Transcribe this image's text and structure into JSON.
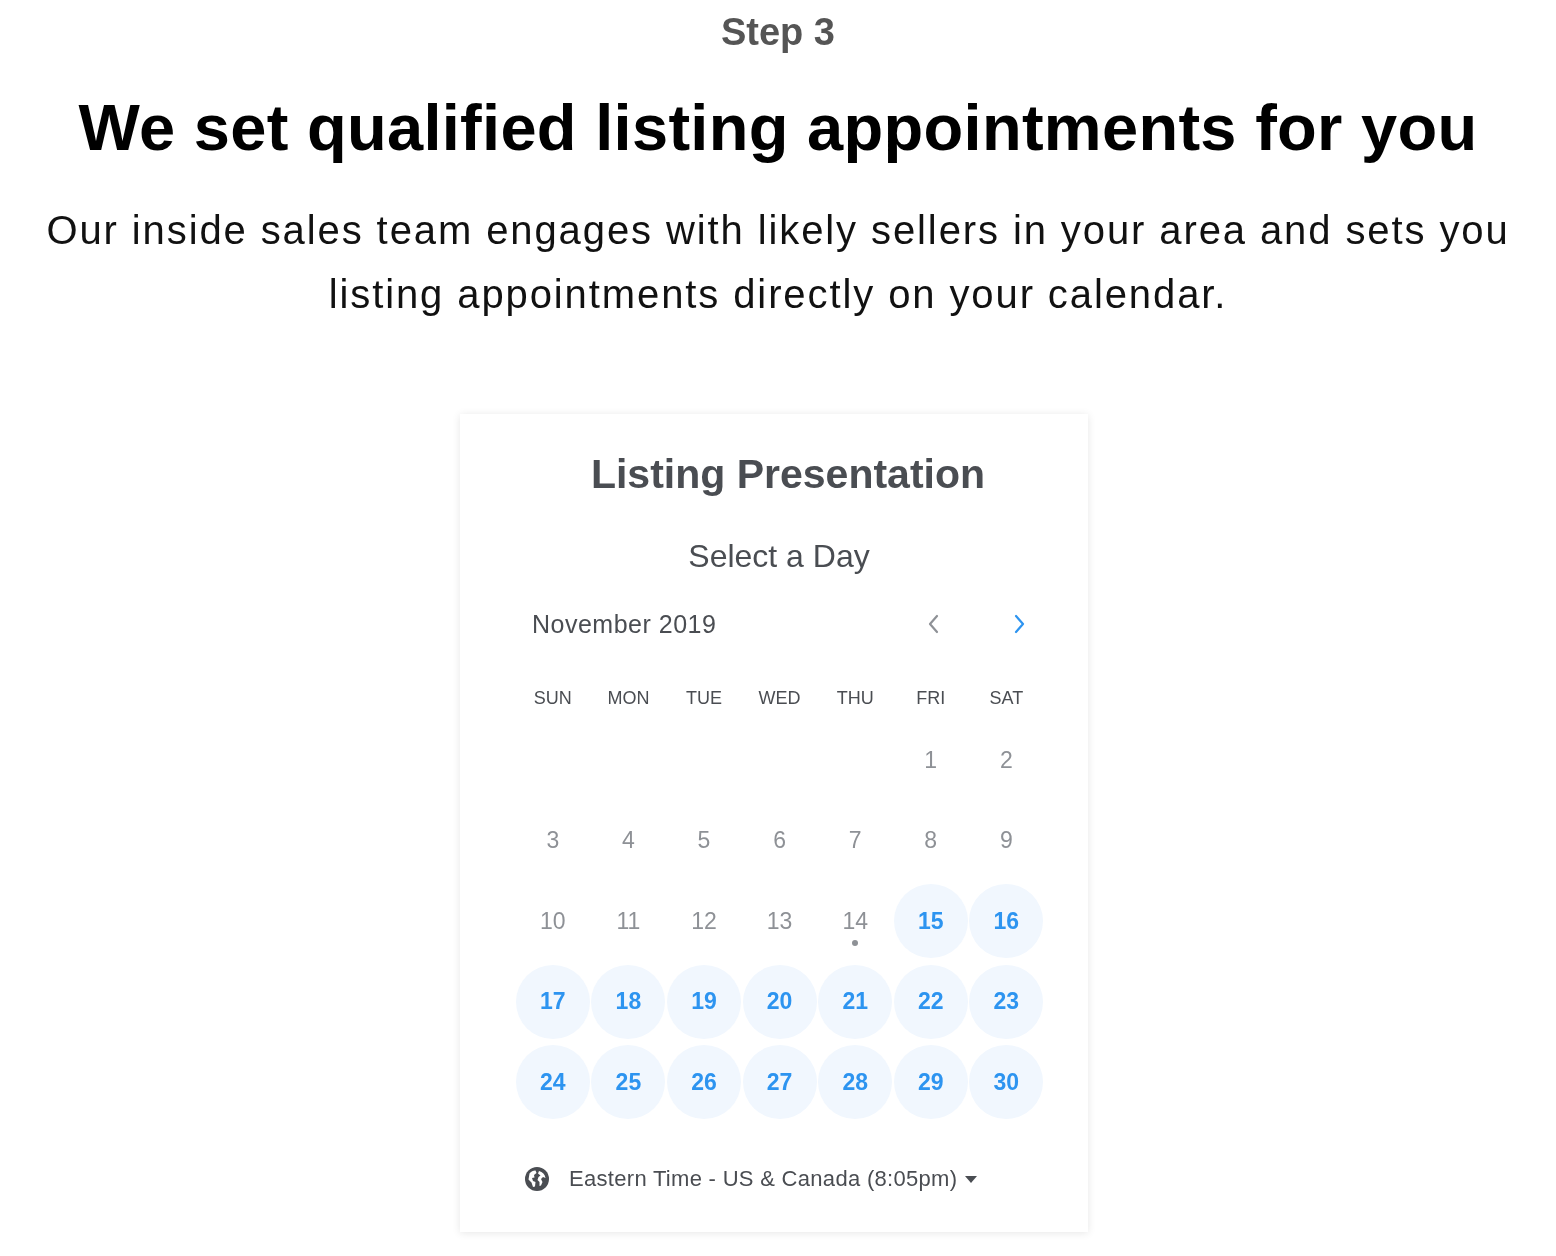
{
  "step": {
    "label": "Step 3"
  },
  "headline": "We set qualified listing appointments for you",
  "description": "Our inside sales team engages with likely sellers in your area and sets you listing appointments directly on your calendar.",
  "scheduler": {
    "title": "Listing Presentation",
    "heading": "Select a Day",
    "month": "November 2019",
    "nav": [
      {
        "kind": "prev",
        "disabled": true
      },
      {
        "kind": "next",
        "disabled": false
      }
    ],
    "weekdays": [
      "SUN",
      "MON",
      "TUE",
      "WED",
      "THU",
      "FRI",
      "SAT"
    ],
    "weeks": [
      [
        {
          "label": "1",
          "available": false,
          "today": false
        },
        {
          "label": "2",
          "available": false,
          "today": false
        }
      ],
      [
        {
          "label": "3",
          "available": false,
          "today": false
        },
        {
          "label": "4",
          "available": false,
          "today": false
        },
        {
          "label": "5",
          "available": false,
          "today": false
        },
        {
          "label": "6",
          "available": false,
          "today": false
        },
        {
          "label": "7",
          "available": false,
          "today": false
        },
        {
          "label": "8",
          "available": false,
          "today": false
        },
        {
          "label": "9",
          "available": false,
          "today": false
        }
      ],
      [
        {
          "label": "10",
          "available": false,
          "today": false
        },
        {
          "label": "11",
          "available": false,
          "today": false
        },
        {
          "label": "12",
          "available": false,
          "today": false
        },
        {
          "label": "13",
          "available": false,
          "today": false
        },
        {
          "label": "14",
          "available": false,
          "today": true
        },
        {
          "label": "15",
          "available": true,
          "today": false
        },
        {
          "label": "16",
          "available": true,
          "today": false
        }
      ],
      [
        {
          "label": "17",
          "available": true,
          "today": false
        },
        {
          "label": "18",
          "available": true,
          "today": false
        },
        {
          "label": "19",
          "available": true,
          "today": false
        },
        {
          "label": "20",
          "available": true,
          "today": false
        },
        {
          "label": "21",
          "available": true,
          "today": false
        },
        {
          "label": "22",
          "available": true,
          "today": false
        },
        {
          "label": "23",
          "available": true,
          "today": false
        }
      ],
      [
        {
          "label": "24",
          "available": true,
          "today": false
        },
        {
          "label": "25",
          "available": true,
          "today": false
        },
        {
          "label": "26",
          "available": true,
          "today": false
        },
        {
          "label": "27",
          "available": true,
          "today": false
        },
        {
          "label": "28",
          "available": true,
          "today": false
        },
        {
          "label": "29",
          "available": true,
          "today": false
        },
        {
          "label": "30",
          "available": true,
          "today": false
        }
      ]
    ],
    "timezone": {
      "value": "Eastern Time - US & Canada (8:05pm)"
    }
  }
}
